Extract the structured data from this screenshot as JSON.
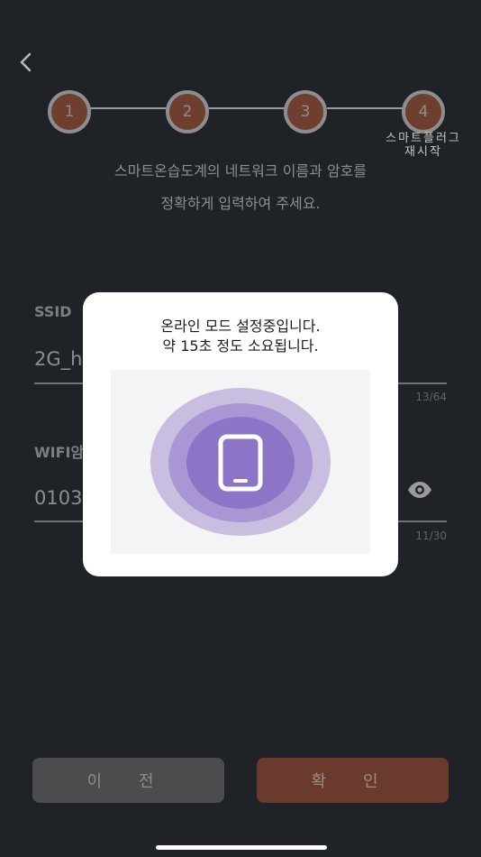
{
  "nav": {
    "back_icon": "chevron-left-icon"
  },
  "steps": {
    "items": [
      "1",
      "2",
      "3",
      "4"
    ],
    "last_caption_line1": "스마트플러그",
    "last_caption_line2": "재시작",
    "active_color": "#6e3f2f"
  },
  "instruction": {
    "line1": "스마트온습도계의 네트워크 이름과 암호를",
    "line2": "정확하게 입력하여 주세요."
  },
  "ssid": {
    "label": "SSID",
    "value": "2G_h",
    "counter": "13/64"
  },
  "wifi": {
    "label": "WIFI암",
    "value": "0103",
    "counter": "11/30",
    "visibility_icon": "eye-icon"
  },
  "buttons": {
    "prev": "이 전",
    "confirm": "확 인"
  },
  "modal": {
    "line1": "온라인 모드 설정중입니다.",
    "line2": "약 15초 정도 소요됩니다.",
    "illustration_icon": "smartphone-icon",
    "ring_colors": [
      "#c9bde0",
      "#a997d3",
      "#8c75c6"
    ]
  }
}
